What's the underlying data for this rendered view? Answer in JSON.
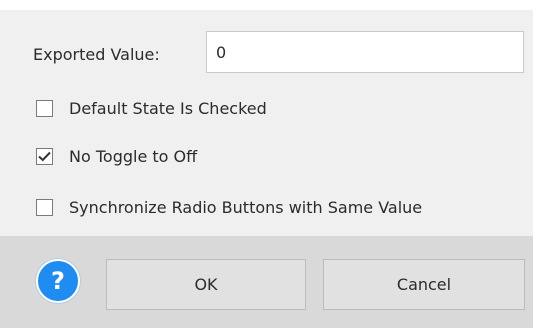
{
  "exported_value": {
    "label": "Exported Value:",
    "value": "0"
  },
  "options": [
    {
      "label": "Default State Is Checked",
      "checked": false
    },
    {
      "label": "No Toggle to Off",
      "checked": true
    },
    {
      "label": "Synchronize Radio Buttons with Same Value",
      "checked": false
    }
  ],
  "footer": {
    "help_glyph": "?",
    "ok_label": "OK",
    "cancel_label": "Cancel"
  },
  "colors": {
    "help_blue": "#1e8cf0",
    "panel": "#f0f0f0",
    "footer": "#d9d9d9"
  }
}
